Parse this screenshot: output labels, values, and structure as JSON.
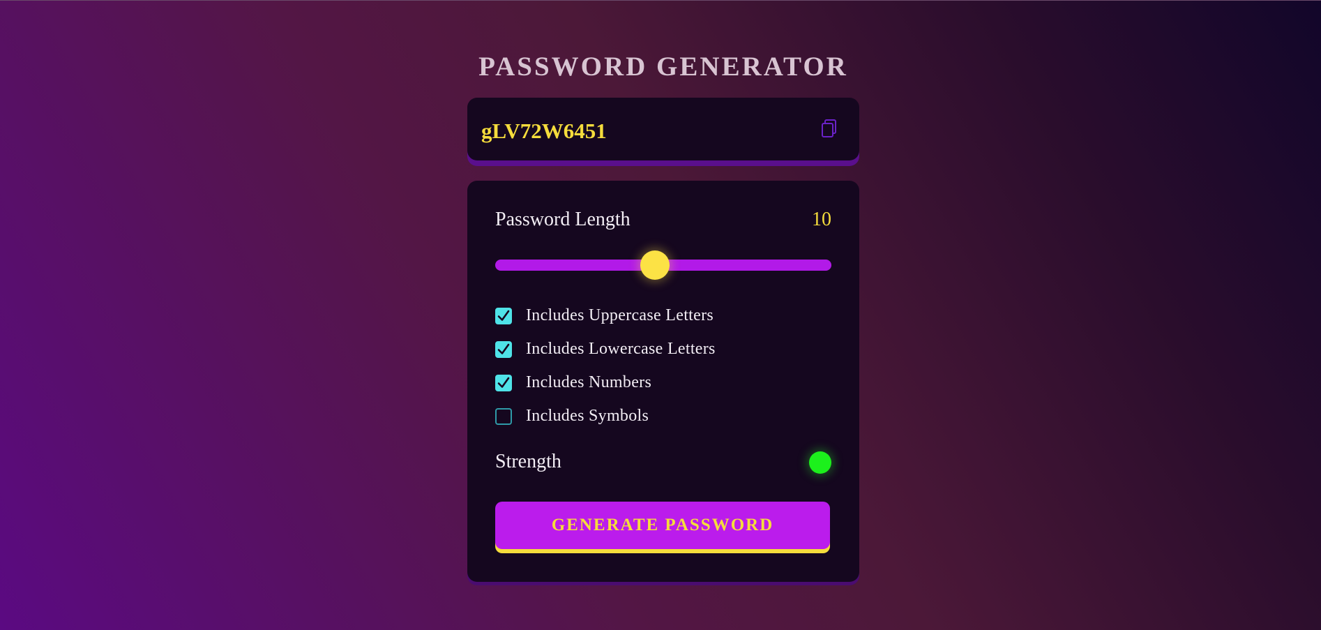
{
  "app": {
    "title": "PASSWORD GENERATOR"
  },
  "output": {
    "password": "gLV72W6451",
    "copy_icon": "copy-icon"
  },
  "length": {
    "label": "Password Length",
    "value": "10",
    "slider_fraction": 0.475
  },
  "options": [
    {
      "label": "Includes Uppercase Letters",
      "checked": true
    },
    {
      "label": "Includes Lowercase Letters",
      "checked": true
    },
    {
      "label": "Includes Numbers",
      "checked": true
    },
    {
      "label": "Includes Symbols",
      "checked": false
    }
  ],
  "strength": {
    "label": "Strength",
    "indicator_color": "#1cf01c"
  },
  "actions": {
    "generate_label": "GENERATE PASSWORD"
  },
  "colors": {
    "accent_yellow": "#f5dc3c",
    "accent_purple": "#bb1cec",
    "checkbox_cyan": "#4fe3e8",
    "panel_bg": "#15071f"
  }
}
